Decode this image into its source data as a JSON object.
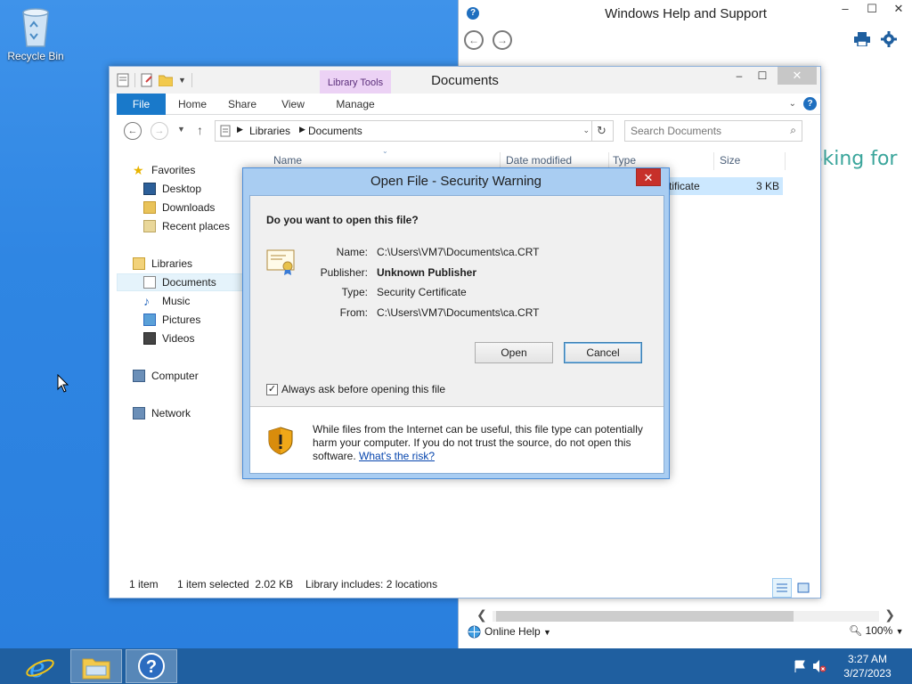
{
  "desktop": {
    "recycle_bin_label": "Recycle Bin"
  },
  "help_window": {
    "title": "Windows Help and Support",
    "body_text_fragment": "oking for",
    "online_help_label": "Online Help",
    "zoom_label": "100%"
  },
  "explorer": {
    "title": "Documents",
    "contextual_tab_group": "Library Tools",
    "tabs": [
      "File",
      "Home",
      "Share",
      "View",
      "Manage"
    ],
    "address": {
      "crumbs": [
        "Libraries",
        "Documents"
      ]
    },
    "search_placeholder": "Search Documents",
    "nav": {
      "favorites": "Favorites",
      "desktop": "Desktop",
      "downloads": "Downloads",
      "recent": "Recent places",
      "libraries": "Libraries",
      "documents": "Documents",
      "music": "Music",
      "pictures": "Pictures",
      "videos": "Videos",
      "computer": "Computer",
      "network": "Network"
    },
    "columns": [
      "Name",
      "Date modified",
      "Type",
      "Size"
    ],
    "row": {
      "type_fragment": "tificate",
      "size": "3 KB"
    },
    "status": {
      "items": "1 item",
      "selected": "1 item selected  2.02 KB",
      "library": "Library includes: 2 locations"
    }
  },
  "dialog": {
    "title": "Open File - Security Warning",
    "question": "Do you want to open this file?",
    "fields": {
      "name_label": "Name:",
      "name_value": "C:\\Users\\VM7\\Documents\\ca.CRT",
      "publisher_label": "Publisher:",
      "publisher_value": "Unknown Publisher",
      "type_label": "Type:",
      "type_value": "Security Certificate",
      "from_label": "From:",
      "from_value": "C:\\Users\\VM7\\Documents\\ca.CRT"
    },
    "open_label": "Open",
    "cancel_label": "Cancel",
    "always_ask_label": "Always ask before opening this file",
    "always_ask_checked": true,
    "warning_text": "While files from the Internet can be useful, this file type can potentially harm your computer. If you do not trust the source, do not open this software.",
    "risk_link": "What's the risk?"
  },
  "taskbar": {
    "time": "3:27 AM",
    "date": "3/27/2023"
  },
  "colors": {
    "accent": "#1979ca",
    "dialog_frame": "#a9cdf2",
    "close_red": "#c7302a",
    "taskbar": "#1f5fa0"
  }
}
